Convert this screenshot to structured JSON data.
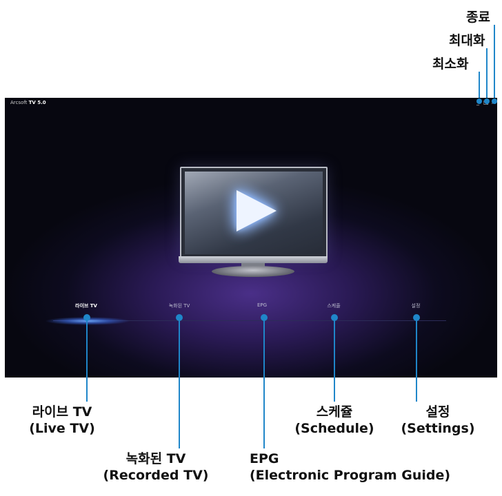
{
  "annotations_top": {
    "close": "종료",
    "maximize": "최대화",
    "minimize": "최소화"
  },
  "app": {
    "title_prefix": "Arcsoft",
    "title_main": "TV 5.0",
    "window_buttons": {
      "minimize": "_",
      "maximize": "□",
      "close": "×"
    }
  },
  "nav": {
    "items": [
      {
        "label": "라이브 TV",
        "active": true
      },
      {
        "label": "녹화된 TV",
        "active": false
      },
      {
        "label": "EPG",
        "active": false
      },
      {
        "label": "스케줄",
        "active": false
      },
      {
        "label": "설정",
        "active": false
      }
    ]
  },
  "annotations_bottom": {
    "live_tv": {
      "line1": "라이브 TV",
      "line2": "(Live TV)"
    },
    "recorded_tv": {
      "line1": "녹화된 TV",
      "line2": "(Recorded TV)"
    },
    "epg": {
      "line1": "EPG",
      "line2": "(Electronic Program Guide)"
    },
    "schedule": {
      "line1": "스케쥴",
      "line2": "(Schedule)"
    },
    "settings": {
      "line1": "설정",
      "line2": "(Settings)"
    }
  },
  "colors": {
    "accent": "#1f86c9",
    "background": "#0d0b1f",
    "glow": "#6ea4ff"
  }
}
